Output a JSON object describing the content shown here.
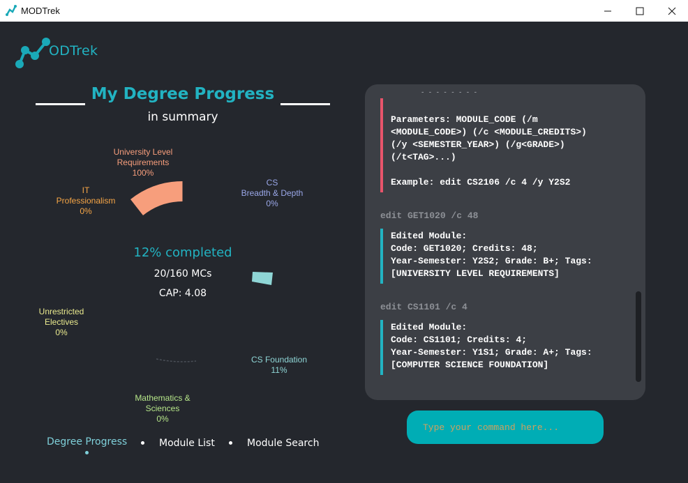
{
  "window": {
    "title": "MODTrek"
  },
  "logo": {
    "text": "ODTrek"
  },
  "progress": {
    "heading": "My Degree Progress",
    "subheading": "in summary",
    "completed_text": "12% completed",
    "mcs_text": "20/160 MCs",
    "cap_text": "CAP: 4.08",
    "categories": [
      {
        "label": "University Level\nRequirements",
        "percent": "100%",
        "color": "#f79e7c"
      },
      {
        "label": "CS\nBreadth & Depth",
        "percent": "0%",
        "color": "#9aa7e8"
      },
      {
        "label": "CS Foundation",
        "percent": "11%",
        "color": "#8fd6d6"
      },
      {
        "label": "Mathematics &\nSciences",
        "percent": "0%",
        "color": "#b6e689"
      },
      {
        "label": "Unrestricted\nElectives",
        "percent": "0%",
        "color": "#eaea8e"
      },
      {
        "label": "IT\nProfessionalism",
        "percent": "0%",
        "color": "#f7a646"
      }
    ]
  },
  "nav": {
    "items": [
      {
        "label": "Degree Progress"
      },
      {
        "label": "Module List"
      },
      {
        "label": "Module Search"
      }
    ]
  },
  "output": {
    "partial_line": "- - - - - - - -",
    "error_block": "Parameters: MODULE_CODE (/m\n<MODULE_CODE>) (/c <MODULE_CREDITS>)\n(/y <SEMESTER_YEAR>) (/g<GRADE>)\n(/t<TAG>...)\n\nExample: edit CS2106 /c 4 /y Y2S2",
    "entries": [
      {
        "command": "edit GET1020 /c 48",
        "result": "Edited Module:\nCode: GET1020; Credits: 48;\nYear-Semester: Y2S2; Grade: B+; Tags:\n[UNIVERSITY LEVEL REQUIREMENTS]"
      },
      {
        "command": "edit CS1101 /c 4",
        "result": "Edited Module:\nCode: CS1101; Credits: 4;\nYear-Semester: Y1S1; Grade: A+; Tags:\n[COMPUTER SCIENCE FOUNDATION]"
      }
    ]
  },
  "command_box": {
    "placeholder": "Type your command here..."
  }
}
